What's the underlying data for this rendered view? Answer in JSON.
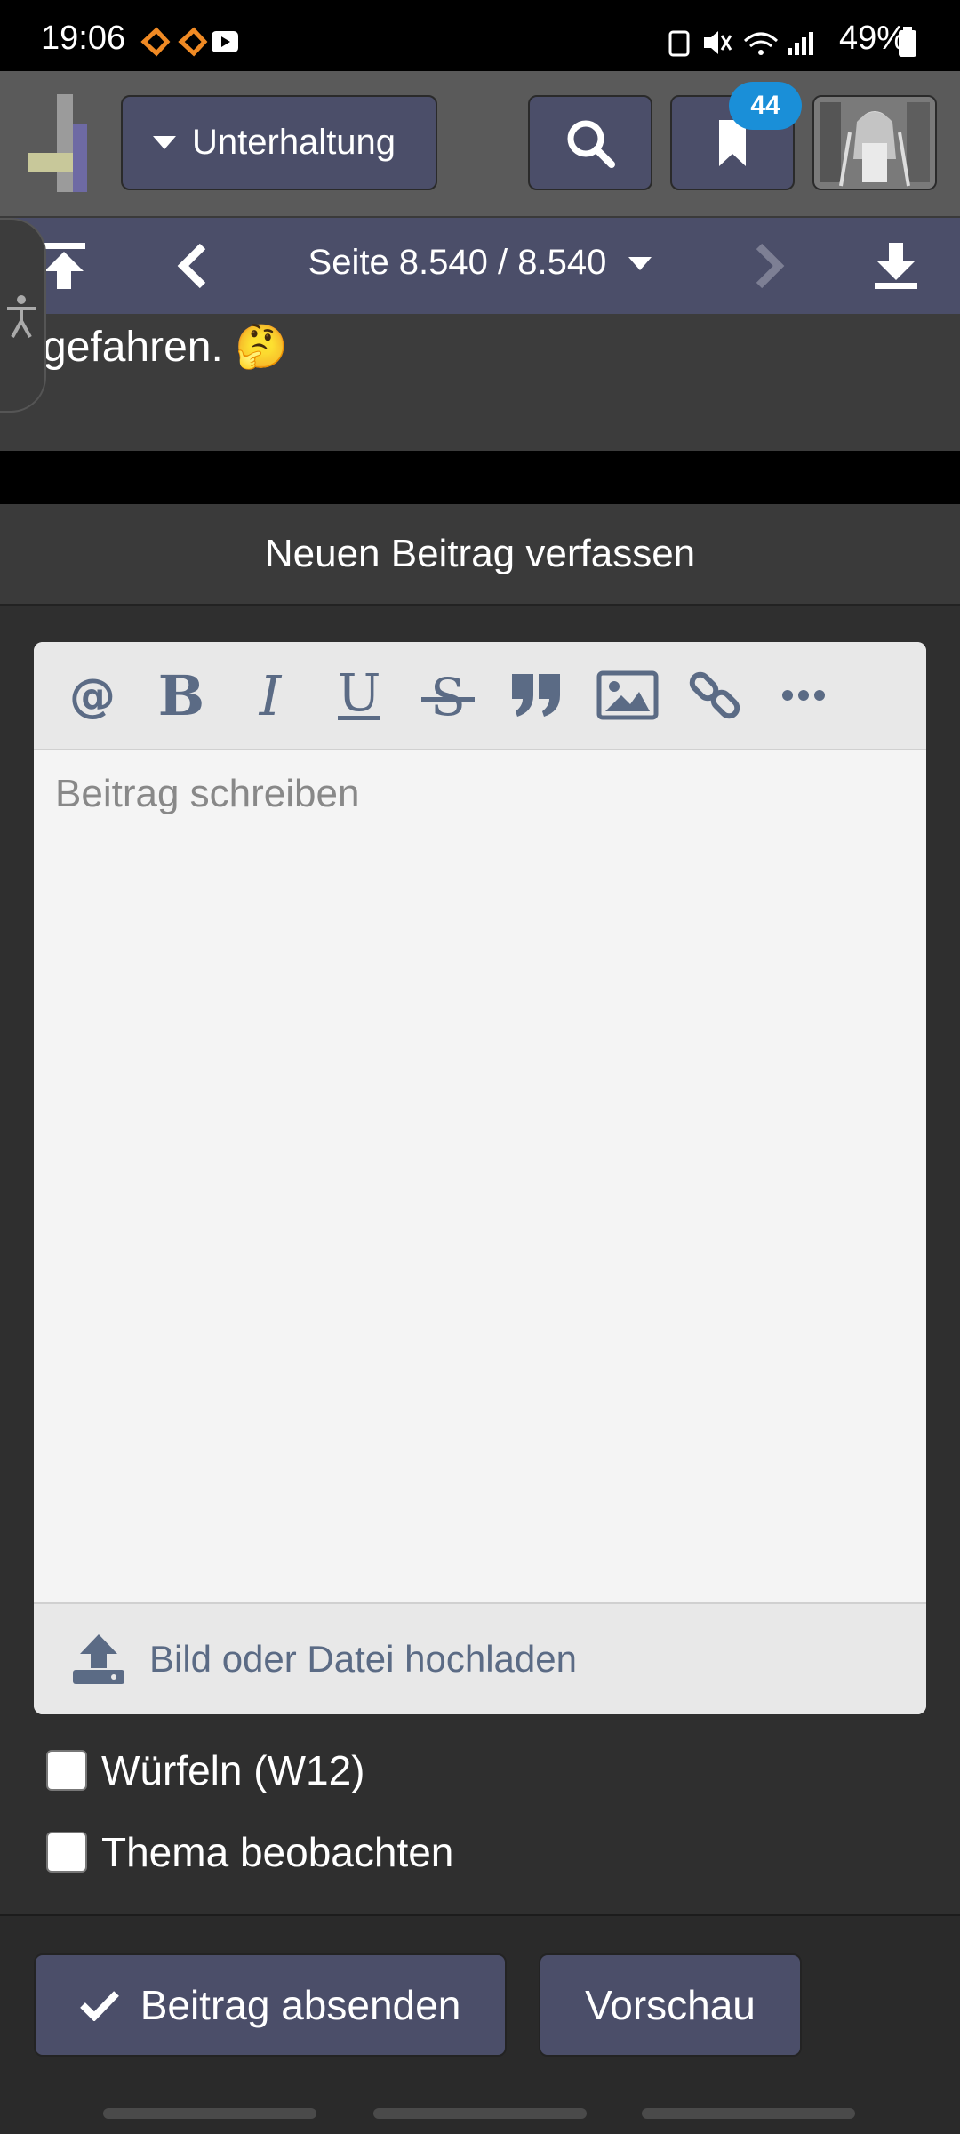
{
  "status_bar": {
    "time": "19:06",
    "battery": "49%"
  },
  "header": {
    "forum_menu_label": "Unterhaltung",
    "bookmarks_count": "44"
  },
  "pager": {
    "page_label": "Seite 8.540 / 8.540"
  },
  "post_excerpt": {
    "text": "gefahren. 🤔"
  },
  "form": {
    "title": "Neuen Beitrag verfassen",
    "editor_placeholder": "Beitrag schreiben",
    "toolbar": [
      "at-icon",
      "bold-icon",
      "italic-icon",
      "underline-icon",
      "strikethrough-icon",
      "quote-icon",
      "image-icon",
      "link-icon",
      "more-icon"
    ],
    "upload_label": "Bild oder Datei hochladen",
    "dice_label": "Würfeln (W12)",
    "watch_label": "Thema beobachten",
    "submit_label": "Beitrag absenden",
    "preview_label": "Vorschau"
  },
  "colors": {
    "accent": "#4b4e69",
    "badge": "#1a8fd8",
    "icon": "#5b6b85"
  }
}
